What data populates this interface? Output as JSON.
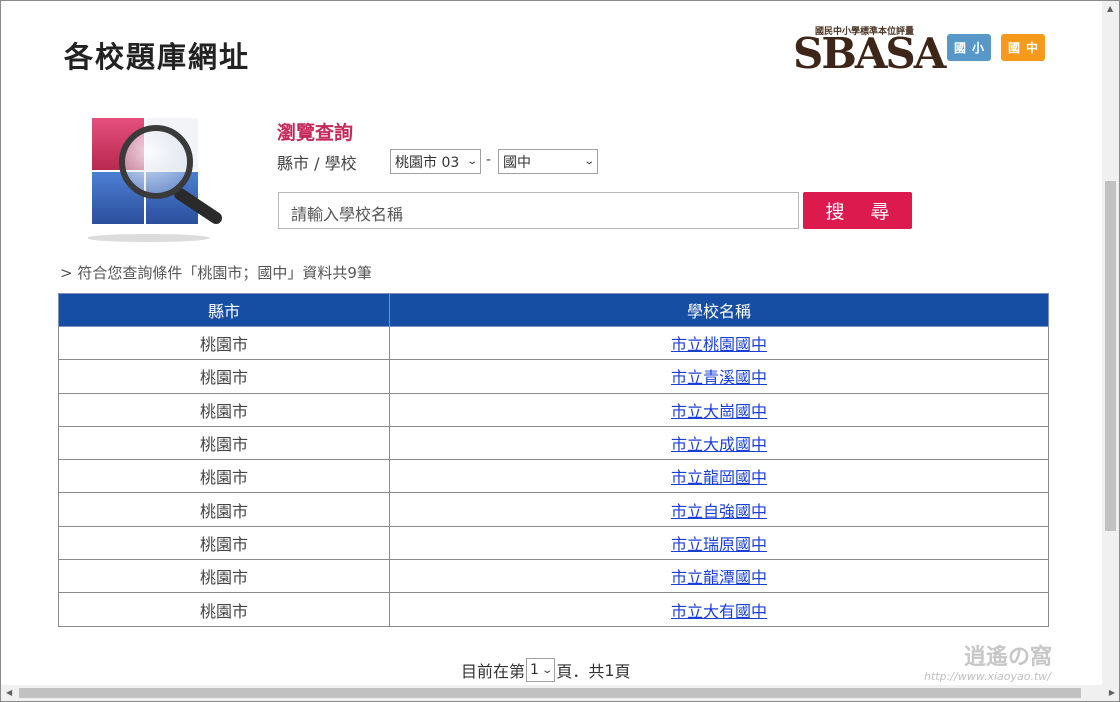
{
  "header": {
    "title": "各校題庫網址",
    "logo_tagline": "國民中小學標準本位評量",
    "logo_word": "SBASA",
    "level_buttons": [
      {
        "label": "國小",
        "color": "#5898c8"
      },
      {
        "label": "國中",
        "color": "#f59a1a"
      }
    ]
  },
  "browse": {
    "title": "瀏覽查詢",
    "filter_label": "縣市 / 學校",
    "city_select": "桃園市 03",
    "dash": "-",
    "level_select": "國中",
    "search_placeholder": "請輸入學校名稱",
    "search_button": "搜 尋"
  },
  "result_summary": "> 符合您查詢條件「桃園市；國中」資料共9筆",
  "table": {
    "headers": [
      "縣市",
      "學校名稱"
    ],
    "rows": [
      {
        "city": "桃園市",
        "school": "市立桃園國中"
      },
      {
        "city": "桃園市",
        "school": "市立青溪國中"
      },
      {
        "city": "桃園市",
        "school": "市立大崗國中"
      },
      {
        "city": "桃園市",
        "school": "市立大成國中"
      },
      {
        "city": "桃園市",
        "school": "市立龍岡國中"
      },
      {
        "city": "桃園市",
        "school": "市立自強國中"
      },
      {
        "city": "桃園市",
        "school": "市立瑞原國中"
      },
      {
        "city": "桃園市",
        "school": "市立龍潭國中"
      },
      {
        "city": "桃園市",
        "school": "市立大有國中"
      }
    ]
  },
  "pager": {
    "prefix": "目前在第",
    "current_page": "1",
    "suffix": "頁．共",
    "total": "1",
    "end": "頁"
  },
  "colors": {
    "table_header": "#164ea4",
    "search_button": "#dc1a4e",
    "browse_title": "#c4295a",
    "link": "#1a3fd6"
  },
  "watermark": "http://www.xiaoyao.tw/"
}
